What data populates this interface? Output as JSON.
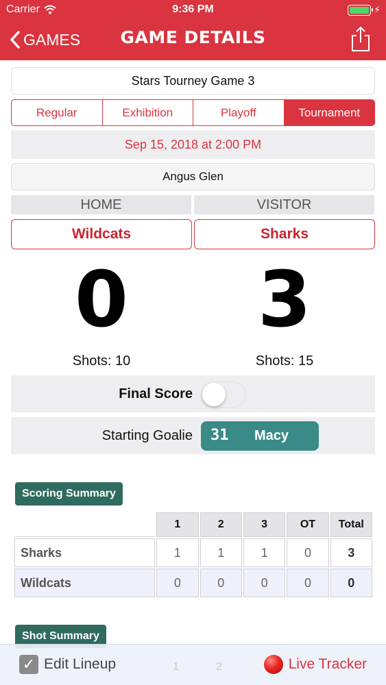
{
  "status_bar": {
    "carrier": "Carrier",
    "time": "9:36 PM",
    "battery_color": "#4cd964"
  },
  "nav": {
    "back_label": "GAMES",
    "title": "GAME DETAILS",
    "share_icon": "share-icon"
  },
  "game": {
    "name": "Stars Tourney Game 3",
    "types": [
      "Regular",
      "Exhibition",
      "Playoff",
      "Tournament"
    ],
    "selected_type": "Tournament",
    "date": "Sep 15, 2018 at 2:00 PM",
    "location": "Angus Glen"
  },
  "teams": {
    "home_header": "HOME",
    "visitor_header": "VISITOR",
    "home_name": "Wildcats",
    "visitor_name": "Sharks",
    "home_score": "0",
    "visitor_score": "3",
    "home_shots": "Shots: 10",
    "visitor_shots": "Shots: 15"
  },
  "final_score": {
    "label": "Final Score",
    "on": false
  },
  "goalie": {
    "label": "Starting Goalie",
    "number": "31",
    "name": "Macy"
  },
  "scoring_summary": {
    "title": "Scoring Summary",
    "columns": [
      "1",
      "2",
      "3",
      "OT",
      "Total"
    ],
    "rows": [
      {
        "team": "Sharks",
        "periods": [
          "1",
          "1",
          "1",
          "0"
        ],
        "total": "3"
      },
      {
        "team": "Wildcats",
        "periods": [
          "0",
          "0",
          "0",
          "0"
        ],
        "total": "0"
      }
    ]
  },
  "shot_summary": {
    "title": "Shot Summary",
    "partial_columns": [
      "1",
      "2"
    ]
  },
  "bottom_bar": {
    "edit_lineup": "Edit Lineup",
    "live_tracker": "Live Tracker"
  },
  "colors": {
    "accent": "#d9343f",
    "goalie": "#3a8b87",
    "section": "#2f6b5e"
  }
}
